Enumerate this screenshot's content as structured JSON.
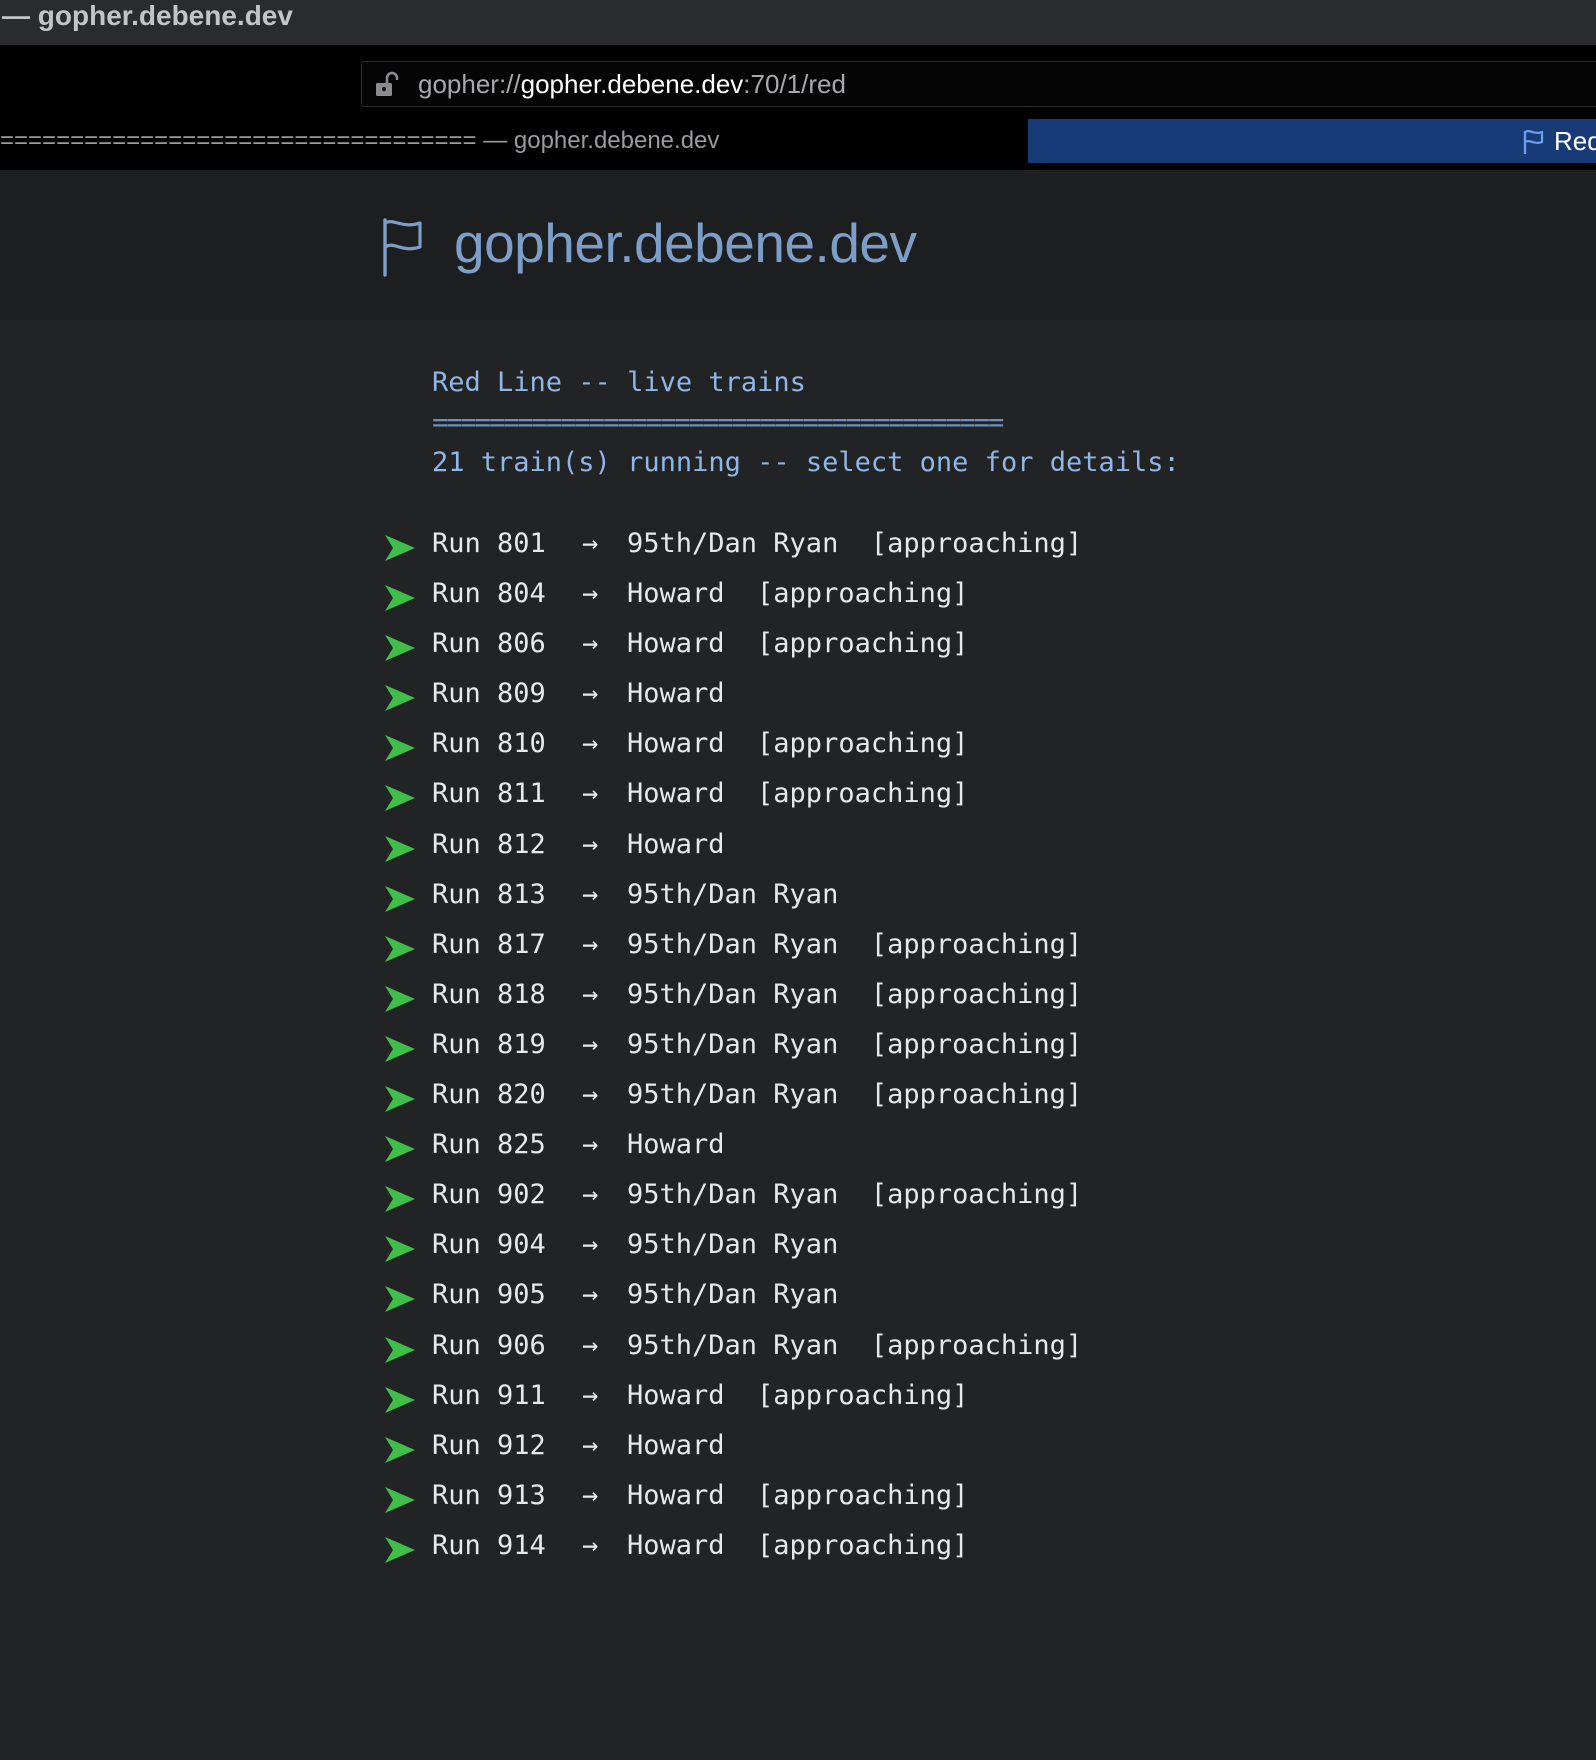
{
  "window": {
    "title": "— gopher.debene.dev"
  },
  "urlbar": {
    "scheme": "gopher://",
    "host": "gopher.debene.dev",
    "path": ":70/1/red"
  },
  "tabs": [
    {
      "label": "================================== — gopher.debene.dev",
      "active": false
    },
    {
      "label": "Red",
      "active": true
    }
  ],
  "site": {
    "title": "gopher.debene.dev"
  },
  "page": {
    "heading": "Red Line -- live trains",
    "rule": "========================================",
    "summary": "21 train(s) running -- select one for details:",
    "arrow_glyph": "→",
    "trains": [
      {
        "label": "Run 801   → 95th/Dan Ryan  [approaching]"
      },
      {
        "label": "Run 804   → Howard  [approaching]"
      },
      {
        "label": "Run 806   → Howard  [approaching]"
      },
      {
        "label": "Run 809   → Howard"
      },
      {
        "label": "Run 810   → Howard  [approaching]"
      },
      {
        "label": "Run 811   → Howard  [approaching]"
      },
      {
        "label": "Run 812   → Howard"
      },
      {
        "label": "Run 813   → 95th/Dan Ryan"
      },
      {
        "label": "Run 817   → 95th/Dan Ryan  [approaching]"
      },
      {
        "label": "Run 818   → 95th/Dan Ryan  [approaching]"
      },
      {
        "label": "Run 819   → 95th/Dan Ryan  [approaching]"
      },
      {
        "label": "Run 820   → 95th/Dan Ryan  [approaching]"
      },
      {
        "label": "Run 825   → Howard"
      },
      {
        "label": "Run 902   → 95th/Dan Ryan  [approaching]"
      },
      {
        "label": "Run 904   → 95th/Dan Ryan"
      },
      {
        "label": "Run 905   → 95th/Dan Ryan"
      },
      {
        "label": "Run 906   → 95th/Dan Ryan  [approaching]"
      },
      {
        "label": "Run 911   → Howard  [approaching]"
      },
      {
        "label": "Run 912   → Howard"
      },
      {
        "label": "Run 913   → Howard  [approaching]"
      },
      {
        "label": "Run 914   → Howard  [approaching]"
      }
    ]
  },
  "icons": {
    "lock": "unlocked-padlock-icon",
    "site_flag": "flag-icon",
    "tab_flag": "flag-icon",
    "train_item": "green-arrow-icon"
  },
  "colors": {
    "title_link": "#7d9ec9",
    "text_blue": "#8fb6e6",
    "item_arrow": "#3fbe4a",
    "active_tab": "#183b78"
  }
}
